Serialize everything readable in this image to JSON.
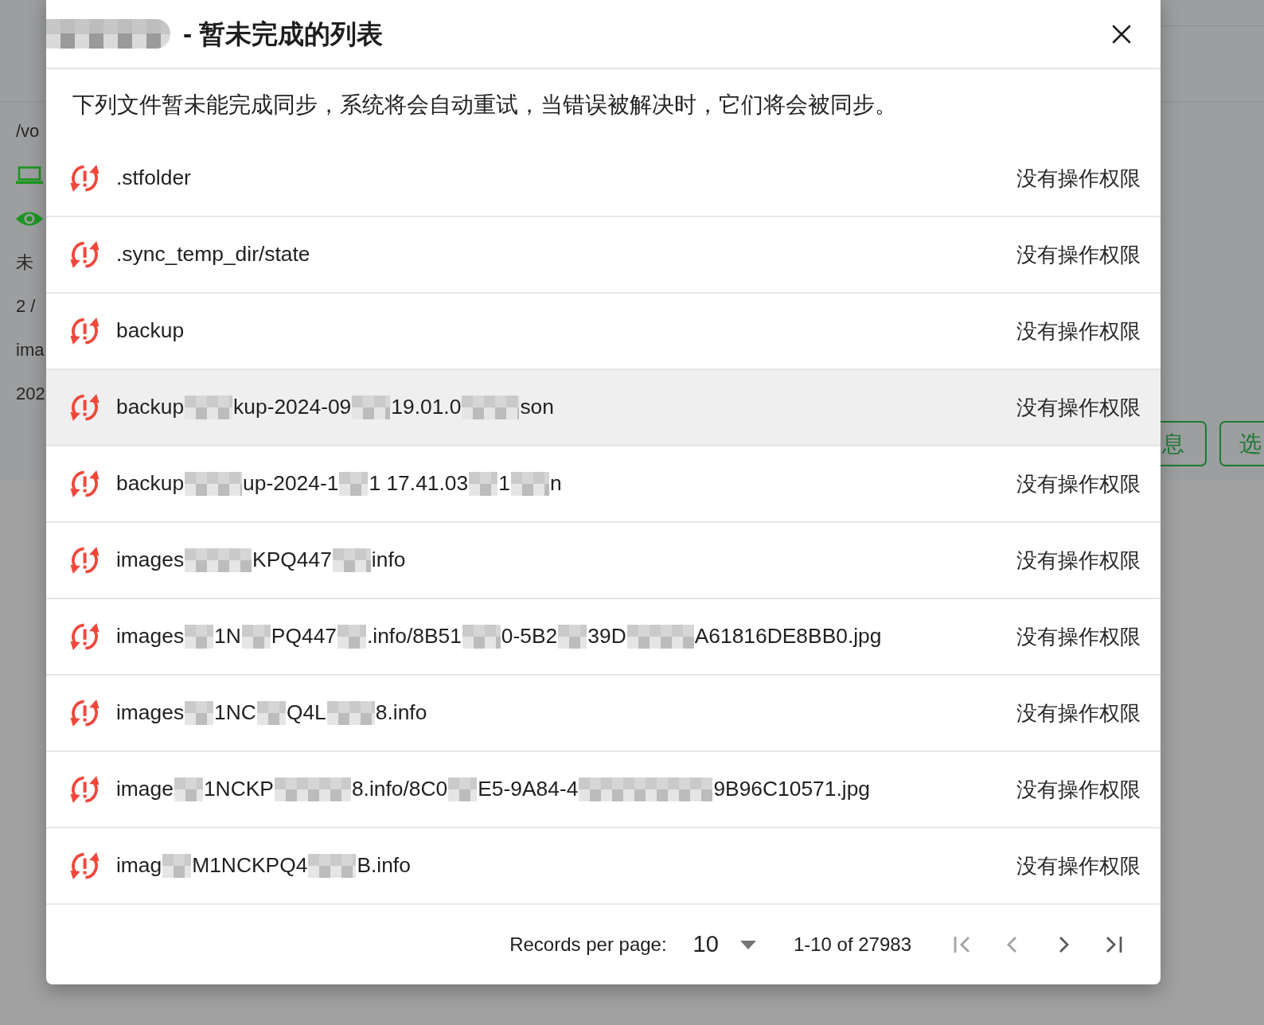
{
  "background": {
    "side_texts": [
      "/vo",
      "未",
      "2 /",
      "ima",
      "202"
    ],
    "buttons": [
      "息",
      "选"
    ]
  },
  "modal": {
    "title": [
      {
        "kind": "mosaic"
      },
      {
        "kind": "mosaic"
      },
      {
        "kind": "mosaic"
      },
      {
        "kind": "mosaic"
      },
      {
        "kind": "mosaic"
      },
      {
        "kind": "mosaic"
      },
      {
        "kind": "mosaic"
      },
      {
        "kind": "mosaic"
      },
      {
        "kind": "mosaic"
      },
      {
        "kind": "mosaic"
      },
      {
        "kind": "mosaic"
      },
      {
        "kind": "mosaic"
      },
      {
        "kind": "mosaic"
      },
      {
        "kind": "text",
        "text": "- 暂未完成的列表"
      }
    ],
    "description": "下列文件暂未能完成同步，系统将会自动重试，当错误被解决时，它们将会被同步。",
    "rows": [
      {
        "segments": [
          {
            "kind": "text",
            "text": ".stfolder"
          }
        ],
        "status": "没有操作权限",
        "highlighted": false
      },
      {
        "segments": [
          {
            "kind": "text",
            "text": ".sync_temp_dir/state"
          }
        ],
        "status": "没有操作权限",
        "highlighted": false
      },
      {
        "segments": [
          {
            "kind": "text",
            "text": "backup"
          }
        ],
        "status": "没有操作权限",
        "highlighted": false
      },
      {
        "segments": [
          {
            "kind": "text",
            "text": "backup"
          },
          {
            "kind": "mosaic"
          },
          {
            "kind": "mosaic"
          },
          {
            "kind": "mosaic"
          },
          {
            "kind": "mosaic"
          },
          {
            "kind": "mosaic"
          },
          {
            "kind": "text",
            "text": "kup-2024-09"
          },
          {
            "kind": "mosaic"
          },
          {
            "kind": "mosaic"
          },
          {
            "kind": "mosaic"
          },
          {
            "kind": "mosaic"
          },
          {
            "kind": "text",
            "text": "19.01.0"
          },
          {
            "kind": "mosaic"
          },
          {
            "kind": "mosaic"
          },
          {
            "kind": "mosaic"
          },
          {
            "kind": "mosaic"
          },
          {
            "kind": "mosaic"
          },
          {
            "kind": "mosaic"
          },
          {
            "kind": "text",
            "text": "son"
          }
        ],
        "status": "没有操作权限",
        "highlighted": true
      },
      {
        "segments": [
          {
            "kind": "text",
            "text": "backup"
          },
          {
            "kind": "mosaic"
          },
          {
            "kind": "mosaic"
          },
          {
            "kind": "mosaic"
          },
          {
            "kind": "mosaic"
          },
          {
            "kind": "mosaic"
          },
          {
            "kind": "mosaic"
          },
          {
            "kind": "text",
            "text": "up-2024-1"
          },
          {
            "kind": "mosaic"
          },
          {
            "kind": "mosaic"
          },
          {
            "kind": "mosaic"
          },
          {
            "kind": "text",
            "text": "1 17.41.03"
          },
          {
            "kind": "mosaic"
          },
          {
            "kind": "mosaic"
          },
          {
            "kind": "mosaic"
          },
          {
            "kind": "text",
            "text": "1"
          },
          {
            "kind": "mosaic"
          },
          {
            "kind": "mosaic"
          },
          {
            "kind": "mosaic"
          },
          {
            "kind": "mosaic"
          },
          {
            "kind": "text",
            "text": "n"
          }
        ],
        "status": "没有操作权限",
        "highlighted": false
      },
      {
        "segments": [
          {
            "kind": "text",
            "text": "images"
          },
          {
            "kind": "mosaic"
          },
          {
            "kind": "mosaic"
          },
          {
            "kind": "mosaic"
          },
          {
            "kind": "mosaic"
          },
          {
            "kind": "mosaic"
          },
          {
            "kind": "mosaic"
          },
          {
            "kind": "mosaic"
          },
          {
            "kind": "text",
            "text": "KPQ447"
          },
          {
            "kind": "mosaic"
          },
          {
            "kind": "mosaic"
          },
          {
            "kind": "mosaic"
          },
          {
            "kind": "mosaic"
          },
          {
            "kind": "text",
            "text": "info"
          }
        ],
        "status": "没有操作权限",
        "highlighted": false
      },
      {
        "segments": [
          {
            "kind": "text",
            "text": "images"
          },
          {
            "kind": "mosaic"
          },
          {
            "kind": "mosaic"
          },
          {
            "kind": "mosaic"
          },
          {
            "kind": "text",
            "text": "1N"
          },
          {
            "kind": "mosaic"
          },
          {
            "kind": "mosaic"
          },
          {
            "kind": "mosaic"
          },
          {
            "kind": "text",
            "text": "PQ447"
          },
          {
            "kind": "mosaic"
          },
          {
            "kind": "mosaic"
          },
          {
            "kind": "mosaic"
          },
          {
            "kind": "text",
            "text": ".info/8B51"
          },
          {
            "kind": "mosaic"
          },
          {
            "kind": "mosaic"
          },
          {
            "kind": "mosaic"
          },
          {
            "kind": "mosaic"
          },
          {
            "kind": "text",
            "text": "0-5B2"
          },
          {
            "kind": "mosaic"
          },
          {
            "kind": "mosaic"
          },
          {
            "kind": "mosaic"
          },
          {
            "kind": "text",
            "text": "39D"
          },
          {
            "kind": "mosaic"
          },
          {
            "kind": "mosaic"
          },
          {
            "kind": "mosaic"
          },
          {
            "kind": "mosaic"
          },
          {
            "kind": "mosaic"
          },
          {
            "kind": "mosaic"
          },
          {
            "kind": "mosaic"
          },
          {
            "kind": "text",
            "text": "A61816DE8BB0.jpg"
          }
        ],
        "status": "没有操作权限",
        "highlighted": false
      },
      {
        "segments": [
          {
            "kind": "text",
            "text": "images"
          },
          {
            "kind": "mosaic"
          },
          {
            "kind": "mosaic"
          },
          {
            "kind": "mosaic"
          },
          {
            "kind": "text",
            "text": "1NC"
          },
          {
            "kind": "mosaic"
          },
          {
            "kind": "mosaic"
          },
          {
            "kind": "mosaic"
          },
          {
            "kind": "text",
            "text": "Q4L"
          },
          {
            "kind": "mosaic"
          },
          {
            "kind": "mosaic"
          },
          {
            "kind": "mosaic"
          },
          {
            "kind": "mosaic"
          },
          {
            "kind": "mosaic"
          },
          {
            "kind": "text",
            "text": "8.info"
          }
        ],
        "status": "没有操作权限",
        "highlighted": false
      },
      {
        "segments": [
          {
            "kind": "text",
            "text": "image"
          },
          {
            "kind": "mosaic"
          },
          {
            "kind": "mosaic"
          },
          {
            "kind": "mosaic"
          },
          {
            "kind": "text",
            "text": "1NCKP"
          },
          {
            "kind": "mosaic"
          },
          {
            "kind": "mosaic"
          },
          {
            "kind": "mosaic"
          },
          {
            "kind": "mosaic"
          },
          {
            "kind": "mosaic"
          },
          {
            "kind": "mosaic"
          },
          {
            "kind": "mosaic"
          },
          {
            "kind": "mosaic"
          },
          {
            "kind": "text",
            "text": "8.info/8C0"
          },
          {
            "kind": "mosaic"
          },
          {
            "kind": "mosaic"
          },
          {
            "kind": "mosaic"
          },
          {
            "kind": "text",
            "text": "E5-9A84-4"
          },
          {
            "kind": "mosaic"
          },
          {
            "kind": "mosaic"
          },
          {
            "kind": "mosaic"
          },
          {
            "kind": "mosaic"
          },
          {
            "kind": "mosaic"
          },
          {
            "kind": "mosaic"
          },
          {
            "kind": "mosaic"
          },
          {
            "kind": "mosaic"
          },
          {
            "kind": "mosaic"
          },
          {
            "kind": "mosaic"
          },
          {
            "kind": "mosaic"
          },
          {
            "kind": "mosaic"
          },
          {
            "kind": "mosaic"
          },
          {
            "kind": "mosaic"
          },
          {
            "kind": "text",
            "text": "9B96C10571.jpg"
          }
        ],
        "status": "没有操作权限",
        "highlighted": false
      },
      {
        "segments": [
          {
            "kind": "text",
            "text": "imag"
          },
          {
            "kind": "mosaic"
          },
          {
            "kind": "mosaic"
          },
          {
            "kind": "mosaic"
          },
          {
            "kind": "text",
            "text": "M1NCKPQ4"
          },
          {
            "kind": "mosaic"
          },
          {
            "kind": "mosaic"
          },
          {
            "kind": "mosaic"
          },
          {
            "kind": "mosaic"
          },
          {
            "kind": "mosaic"
          },
          {
            "kind": "text",
            "text": "B.info"
          }
        ],
        "status": "没有操作权限",
        "highlighted": false
      }
    ],
    "pagination": {
      "label": "Records per page:",
      "per_page": "10",
      "range": "1-10 of 27983",
      "buttons": [
        {
          "kind": "first",
          "disabled": true
        },
        {
          "kind": "prev",
          "disabled": true
        },
        {
          "kind": "next",
          "disabled": false
        },
        {
          "kind": "last",
          "disabled": false
        }
      ]
    }
  }
}
